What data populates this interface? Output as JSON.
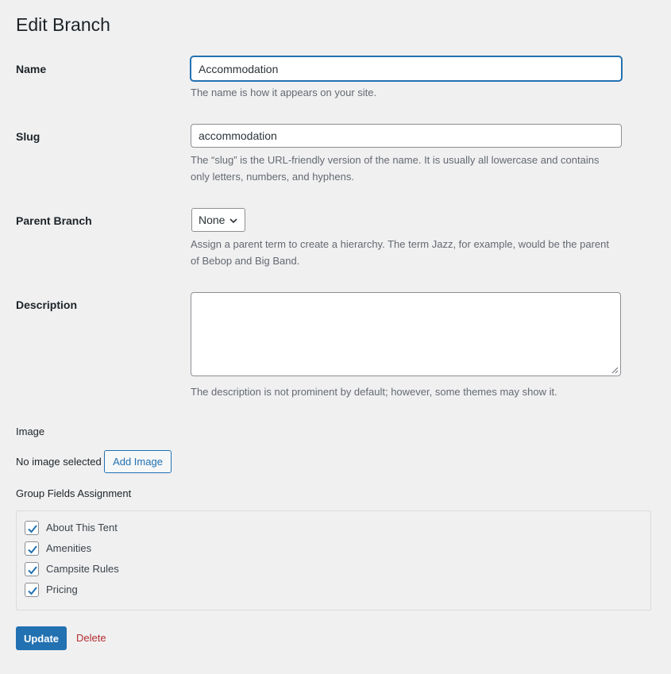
{
  "page": {
    "title": "Edit Branch"
  },
  "fields": {
    "name": {
      "label": "Name",
      "value": "Accommodation",
      "help": "The name is how it appears on your site."
    },
    "slug": {
      "label": "Slug",
      "value": "accommodation",
      "help": "The “slug” is the URL-friendly version of the name. It is usually all lowercase and contains only letters, numbers, and hyphens."
    },
    "parent": {
      "label": "Parent Branch",
      "selected": "None",
      "help": "Assign a parent term to create a hierarchy. The term Jazz, for example, would be the parent of Bebop and Big Band."
    },
    "description": {
      "label": "Description",
      "value": "",
      "help": "The description is not prominent by default; however, some themes may show it."
    }
  },
  "image": {
    "label": "Image",
    "status": "No image selected",
    "add_label": "Add Image"
  },
  "group_fields": {
    "label": "Group Fields Assignment",
    "items": [
      {
        "label": "About This Tent",
        "checked": true
      },
      {
        "label": "Amenities",
        "checked": true
      },
      {
        "label": "Campsite Rules",
        "checked": true
      },
      {
        "label": "Pricing",
        "checked": true
      }
    ]
  },
  "actions": {
    "update_label": "Update",
    "delete_label": "Delete"
  },
  "colors": {
    "accent": "#2271b1",
    "danger": "#b32d2e",
    "background": "#f0f0f1"
  },
  "icons": {
    "select_caret": "chevron-down-icon",
    "checkmark": "checkmark-icon",
    "resize": "resize-grip-icon"
  }
}
